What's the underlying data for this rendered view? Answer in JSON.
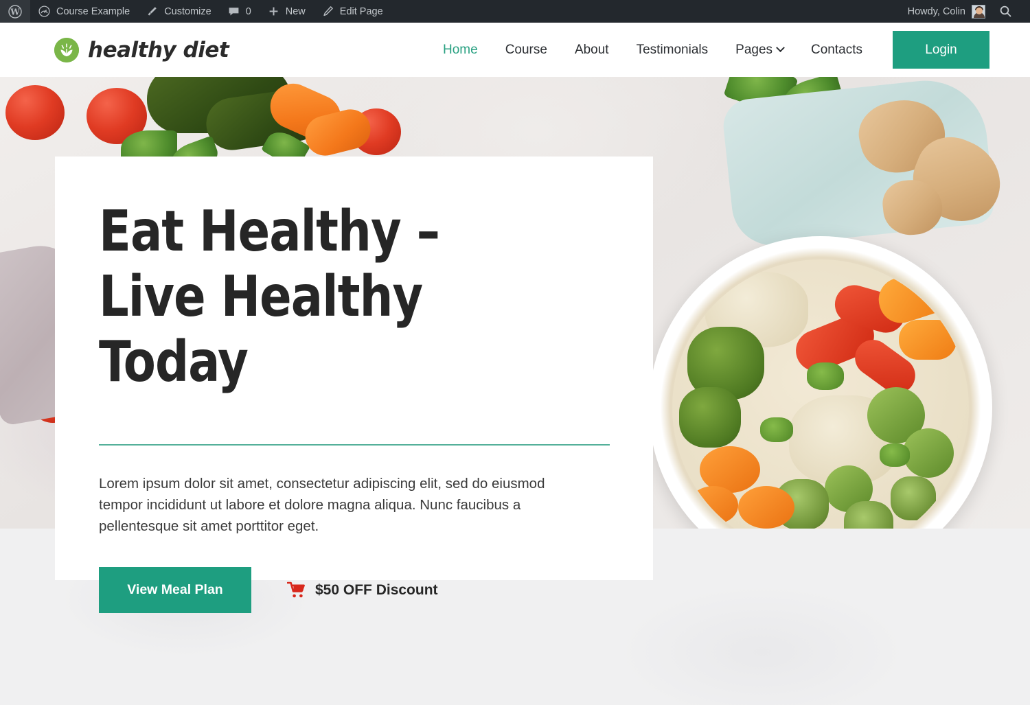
{
  "adminbar": {
    "wp_logo": "wordpress-logo-icon",
    "items": [
      {
        "label": "Course Example",
        "icon": "dashboard-icon",
        "name": "site-name"
      },
      {
        "label": "Customize",
        "icon": "paintbrush-icon",
        "name": "customize"
      },
      {
        "label": "0",
        "icon": "comment-bubble-icon",
        "name": "comments"
      },
      {
        "label": "New",
        "icon": "plus-icon",
        "name": "new-content"
      },
      {
        "label": "Edit Page",
        "icon": "pencil-icon",
        "name": "edit-page"
      }
    ],
    "howdy": "Howdy, Colin",
    "search_icon": "search-icon",
    "avatar": "user-avatar"
  },
  "header": {
    "brand_name": "healthy diet",
    "brand_mark": "leaf-sprout-icon",
    "nav": [
      {
        "label": "Home",
        "active": true,
        "has_dropdown": false
      },
      {
        "label": "Course",
        "active": false,
        "has_dropdown": false
      },
      {
        "label": "About",
        "active": false,
        "has_dropdown": false
      },
      {
        "label": "Testimonials",
        "active": false,
        "has_dropdown": false
      },
      {
        "label": "Pages",
        "active": false,
        "has_dropdown": true
      },
      {
        "label": "Contacts",
        "active": false,
        "has_dropdown": false
      }
    ],
    "login_label": "Login"
  },
  "hero": {
    "title": "Eat Healthy –\nLive Healthy Today",
    "paragraph": "Lorem ipsum dolor sit amet, consectetur adipiscing elit, sed do eiusmod tempor incididunt ut labore et dolore magna aliqua. Nunc faucibus a pellentesque sit amet porttitor eget.",
    "primary_cta": "View Meal Plan",
    "discount_label": "$50 OFF Discount",
    "discount_icon": "shopping-cart-icon",
    "background_image": "healthy-food-bowl-vegetables-photo"
  },
  "colors": {
    "accent_teal": "#1e9e80",
    "nav_active": "#2aa182",
    "brand_green": "#7ab648",
    "cart_red": "#d8281c",
    "adminbar_bg": "#23282d",
    "divider": "#54b09a",
    "page_bg": "#f0f0f1"
  }
}
